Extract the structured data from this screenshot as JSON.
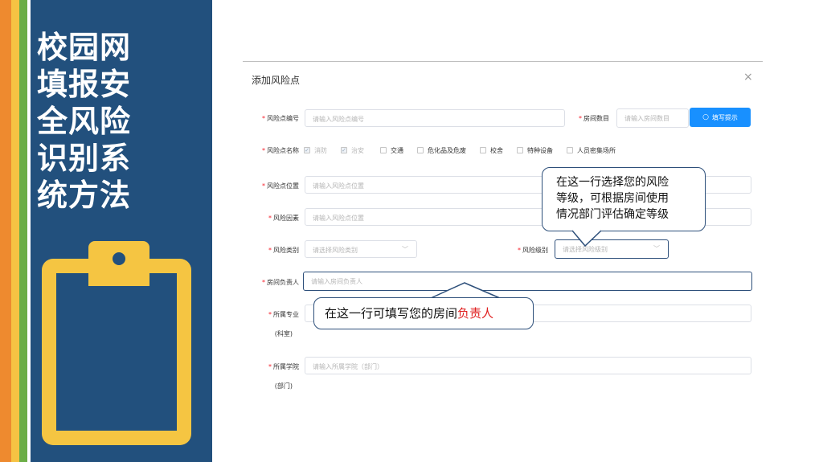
{
  "sidebar": {
    "title_lines": [
      "校园网",
      "填报安",
      "全风险",
      "识别系",
      "统方法"
    ]
  },
  "dialog": {
    "title": "添加风险点",
    "close": "×",
    "fields": {
      "code": {
        "label": "风险点编号",
        "placeholder": "请输入风险点编号"
      },
      "room_count": {
        "label": "房间数目",
        "placeholder": "请输入房间数目"
      },
      "tip_button": "填写提示",
      "name": {
        "label": "风险点名称"
      },
      "location": {
        "label": "风险点位置",
        "placeholder": "请输入风险点位置"
      },
      "factor": {
        "label": "风险因素",
        "placeholder": "请输入风险点位置"
      },
      "category": {
        "label": "风险类别",
        "placeholder": "请选择风险类别"
      },
      "level": {
        "label": "风险级别",
        "placeholder": "请选择风险级别"
      },
      "owner": {
        "label": "房间负责人",
        "placeholder": "请输入房间负责人"
      },
      "major": {
        "label": "所属专业",
        "label2": "(科室)"
      },
      "college": {
        "label": "所属学院",
        "label2": "(部门)",
        "placeholder": "请输入所属学院（部门）"
      }
    },
    "name_options": [
      {
        "label": "消防",
        "checked": true
      },
      {
        "label": "治安",
        "checked": true
      },
      {
        "label": "交通",
        "checked": false
      },
      {
        "label": "危化品及危废",
        "checked": false
      },
      {
        "label": "校舍",
        "checked": false
      },
      {
        "label": "特种设备",
        "checked": false
      },
      {
        "label": "人员密集场所",
        "checked": false
      }
    ]
  },
  "callouts": {
    "level_lines": [
      "在这一行选择您的风险",
      "等级，可根据房间使用",
      "情况部门评估确定等级"
    ],
    "owner_prefix": "在这一行可填写您的房间",
    "owner_highlight": "负责人"
  },
  "colors": {
    "sidebar_bg": "#22507d",
    "accent_yellow": "#f5c542",
    "primary_button": "#1890ff",
    "highlight_red": "#e02020"
  },
  "icons": {
    "clipboard": "clipboard-icon",
    "search": "search-icon"
  }
}
